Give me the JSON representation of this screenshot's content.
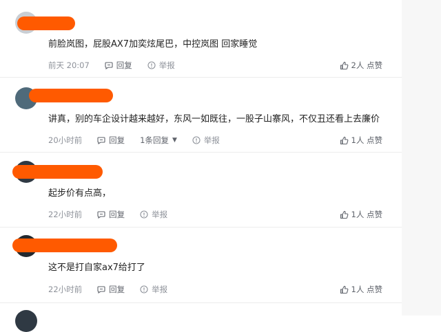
{
  "comments": [
    {
      "text": "前脸岚图，屁股AX7加奕炫尾巴，中控岚图 回家睡觉",
      "time": "前天 20:07",
      "reply_label": "回复",
      "report_label": "举报",
      "likes": "2人 点赞"
    },
    {
      "text": "讲真，别的车企设计越来越好，东风一如既往，一股子山寨风，不仅丑还看上去廉价",
      "time": "20小时前",
      "reply_label": "回复",
      "reply_count": "1条回复",
      "report_label": "举报",
      "likes": "1人 点赞"
    },
    {
      "text": "起步价有点高，",
      "time": "22小时前",
      "reply_label": "回复",
      "report_label": "举报",
      "likes": "1人 点赞"
    },
    {
      "text": "这不是打自家ax7给打了",
      "time": "22小时前",
      "reply_label": "回复",
      "report_label": "举报",
      "likes": "1人 点赞"
    }
  ],
  "colors": {
    "redaction": "#ff5a00",
    "muted_text": "#8d9199",
    "body_text": "#222222"
  },
  "icons": [
    "reply-icon",
    "report-icon",
    "like-icon",
    "dropdown-caret-icon"
  ]
}
